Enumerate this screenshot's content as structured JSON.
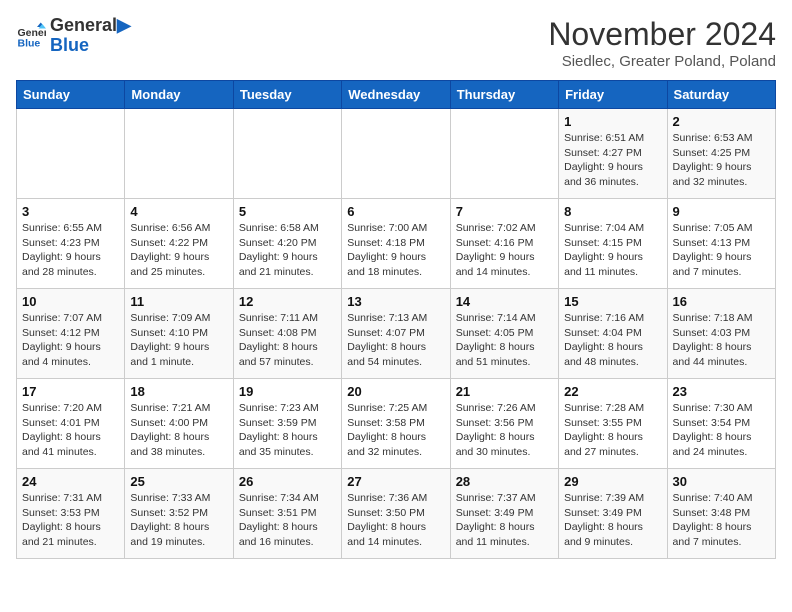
{
  "header": {
    "logo_general": "General",
    "logo_blue": "Blue",
    "month_year": "November 2024",
    "location": "Siedlec, Greater Poland, Poland"
  },
  "days_of_week": [
    "Sunday",
    "Monday",
    "Tuesday",
    "Wednesday",
    "Thursday",
    "Friday",
    "Saturday"
  ],
  "weeks": [
    [
      {
        "day": "",
        "info": ""
      },
      {
        "day": "",
        "info": ""
      },
      {
        "day": "",
        "info": ""
      },
      {
        "day": "",
        "info": ""
      },
      {
        "day": "",
        "info": ""
      },
      {
        "day": "1",
        "info": "Sunrise: 6:51 AM\nSunset: 4:27 PM\nDaylight: 9 hours and 36 minutes."
      },
      {
        "day": "2",
        "info": "Sunrise: 6:53 AM\nSunset: 4:25 PM\nDaylight: 9 hours and 32 minutes."
      }
    ],
    [
      {
        "day": "3",
        "info": "Sunrise: 6:55 AM\nSunset: 4:23 PM\nDaylight: 9 hours and 28 minutes."
      },
      {
        "day": "4",
        "info": "Sunrise: 6:56 AM\nSunset: 4:22 PM\nDaylight: 9 hours and 25 minutes."
      },
      {
        "day": "5",
        "info": "Sunrise: 6:58 AM\nSunset: 4:20 PM\nDaylight: 9 hours and 21 minutes."
      },
      {
        "day": "6",
        "info": "Sunrise: 7:00 AM\nSunset: 4:18 PM\nDaylight: 9 hours and 18 minutes."
      },
      {
        "day": "7",
        "info": "Sunrise: 7:02 AM\nSunset: 4:16 PM\nDaylight: 9 hours and 14 minutes."
      },
      {
        "day": "8",
        "info": "Sunrise: 7:04 AM\nSunset: 4:15 PM\nDaylight: 9 hours and 11 minutes."
      },
      {
        "day": "9",
        "info": "Sunrise: 7:05 AM\nSunset: 4:13 PM\nDaylight: 9 hours and 7 minutes."
      }
    ],
    [
      {
        "day": "10",
        "info": "Sunrise: 7:07 AM\nSunset: 4:12 PM\nDaylight: 9 hours and 4 minutes."
      },
      {
        "day": "11",
        "info": "Sunrise: 7:09 AM\nSunset: 4:10 PM\nDaylight: 9 hours and 1 minute."
      },
      {
        "day": "12",
        "info": "Sunrise: 7:11 AM\nSunset: 4:08 PM\nDaylight: 8 hours and 57 minutes."
      },
      {
        "day": "13",
        "info": "Sunrise: 7:13 AM\nSunset: 4:07 PM\nDaylight: 8 hours and 54 minutes."
      },
      {
        "day": "14",
        "info": "Sunrise: 7:14 AM\nSunset: 4:05 PM\nDaylight: 8 hours and 51 minutes."
      },
      {
        "day": "15",
        "info": "Sunrise: 7:16 AM\nSunset: 4:04 PM\nDaylight: 8 hours and 48 minutes."
      },
      {
        "day": "16",
        "info": "Sunrise: 7:18 AM\nSunset: 4:03 PM\nDaylight: 8 hours and 44 minutes."
      }
    ],
    [
      {
        "day": "17",
        "info": "Sunrise: 7:20 AM\nSunset: 4:01 PM\nDaylight: 8 hours and 41 minutes."
      },
      {
        "day": "18",
        "info": "Sunrise: 7:21 AM\nSunset: 4:00 PM\nDaylight: 8 hours and 38 minutes."
      },
      {
        "day": "19",
        "info": "Sunrise: 7:23 AM\nSunset: 3:59 PM\nDaylight: 8 hours and 35 minutes."
      },
      {
        "day": "20",
        "info": "Sunrise: 7:25 AM\nSunset: 3:58 PM\nDaylight: 8 hours and 32 minutes."
      },
      {
        "day": "21",
        "info": "Sunrise: 7:26 AM\nSunset: 3:56 PM\nDaylight: 8 hours and 30 minutes."
      },
      {
        "day": "22",
        "info": "Sunrise: 7:28 AM\nSunset: 3:55 PM\nDaylight: 8 hours and 27 minutes."
      },
      {
        "day": "23",
        "info": "Sunrise: 7:30 AM\nSunset: 3:54 PM\nDaylight: 8 hours and 24 minutes."
      }
    ],
    [
      {
        "day": "24",
        "info": "Sunrise: 7:31 AM\nSunset: 3:53 PM\nDaylight: 8 hours and 21 minutes."
      },
      {
        "day": "25",
        "info": "Sunrise: 7:33 AM\nSunset: 3:52 PM\nDaylight: 8 hours and 19 minutes."
      },
      {
        "day": "26",
        "info": "Sunrise: 7:34 AM\nSunset: 3:51 PM\nDaylight: 8 hours and 16 minutes."
      },
      {
        "day": "27",
        "info": "Sunrise: 7:36 AM\nSunset: 3:50 PM\nDaylight: 8 hours and 14 minutes."
      },
      {
        "day": "28",
        "info": "Sunrise: 7:37 AM\nSunset: 3:49 PM\nDaylight: 8 hours and 11 minutes."
      },
      {
        "day": "29",
        "info": "Sunrise: 7:39 AM\nSunset: 3:49 PM\nDaylight: 8 hours and 9 minutes."
      },
      {
        "day": "30",
        "info": "Sunrise: 7:40 AM\nSunset: 3:48 PM\nDaylight: 8 hours and 7 minutes."
      }
    ]
  ]
}
